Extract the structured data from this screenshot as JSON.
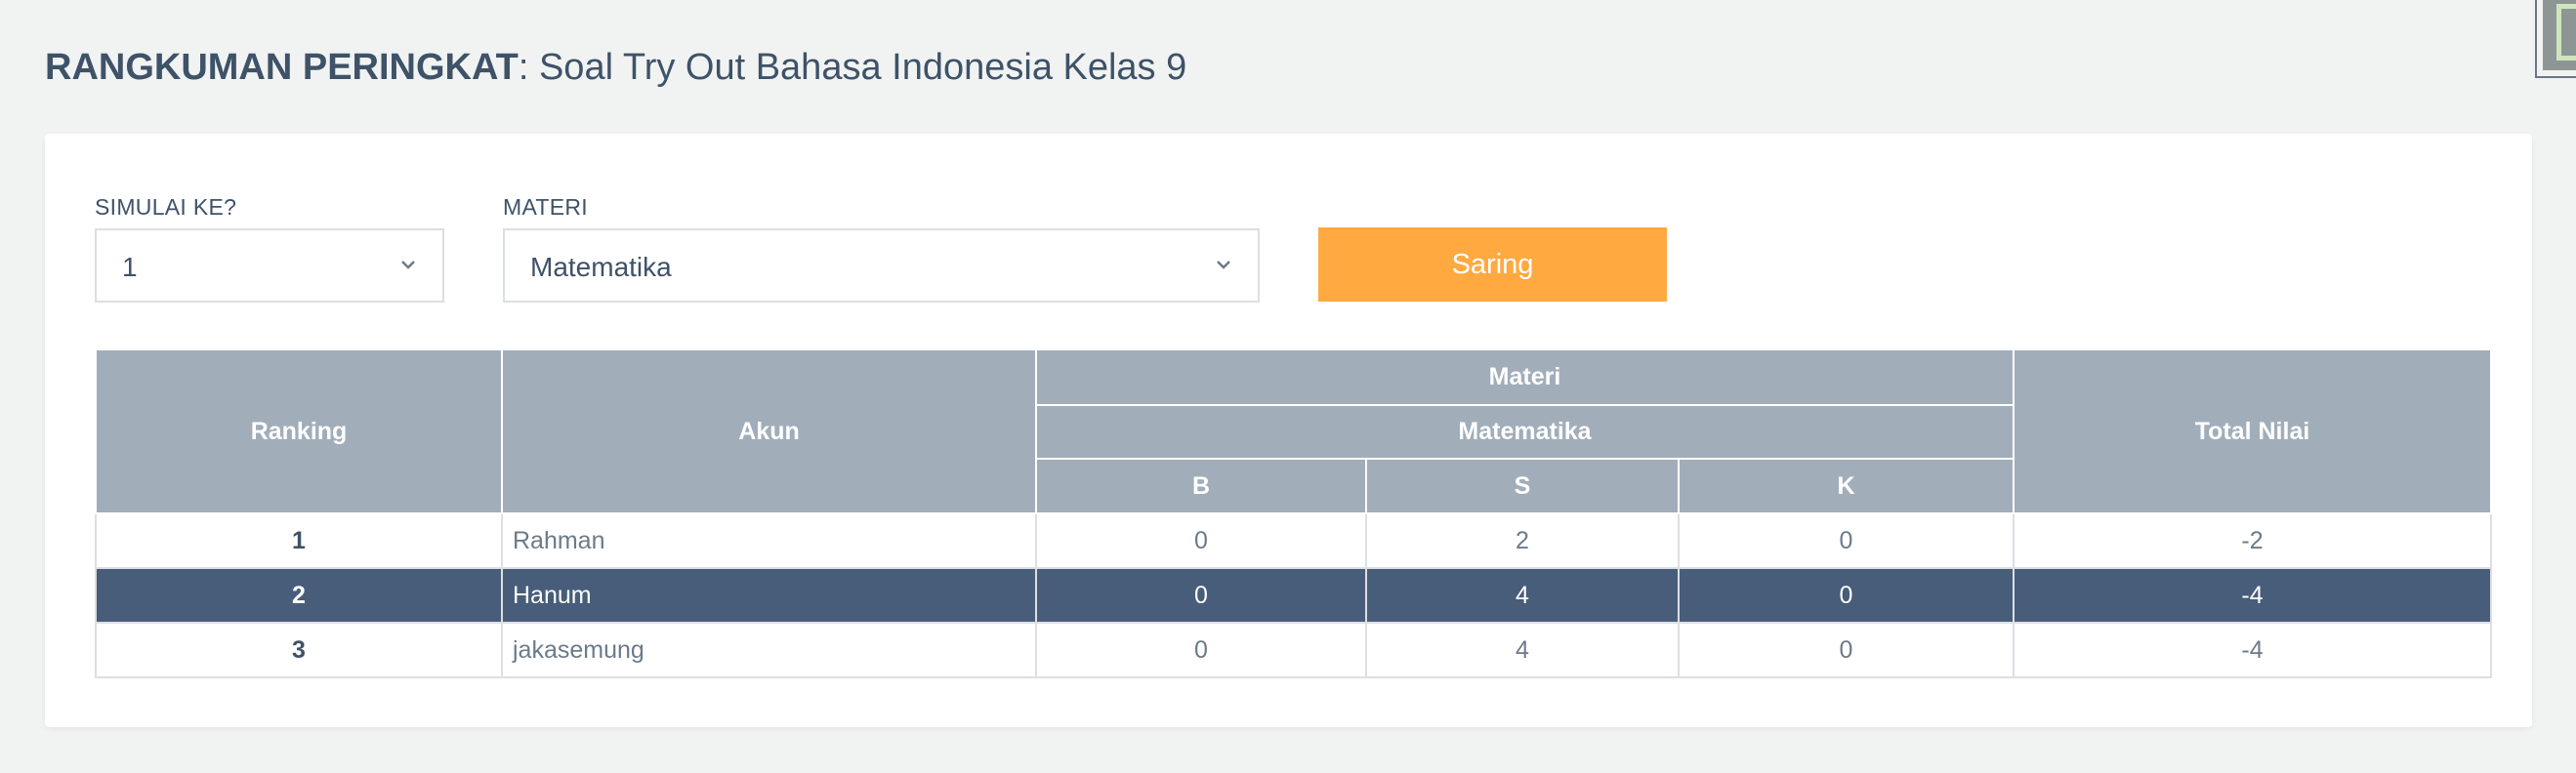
{
  "header": {
    "title_bold": "RANGKUMAN PERINGKAT",
    "title_rest": ": Soal Try Out Bahasa Indonesia Kelas 9"
  },
  "filters": {
    "simulasi": {
      "label": "SIMULAI KE?",
      "value": "1",
      "icon": "chevron-down-icon"
    },
    "materi": {
      "label": "MATERI",
      "value": "Matematika",
      "icon": "chevron-down-icon"
    },
    "submit_label": "Saring"
  },
  "table": {
    "headers": {
      "ranking": "Ranking",
      "akun": "Akun",
      "materi": "Materi",
      "subject": "Matematika",
      "b": "B",
      "s": "S",
      "k": "K",
      "total": "Total Nilai"
    },
    "rows": [
      {
        "rank": "1",
        "akun": "Rahman",
        "b": "0",
        "s": "2",
        "k": "0",
        "total": "-2",
        "highlighted": false
      },
      {
        "rank": "2",
        "akun": "Hanum",
        "b": "0",
        "s": "4",
        "k": "0",
        "total": "-4",
        "highlighted": true
      },
      {
        "rank": "3",
        "akun": "jakasemung",
        "b": "0",
        "s": "4",
        "k": "0",
        "total": "-4",
        "highlighted": false
      }
    ]
  },
  "colors": {
    "accent_button": "#ffa940",
    "header_bg": "#a2adba",
    "highlight_row": "#485d79",
    "text": "#3e5268"
  }
}
